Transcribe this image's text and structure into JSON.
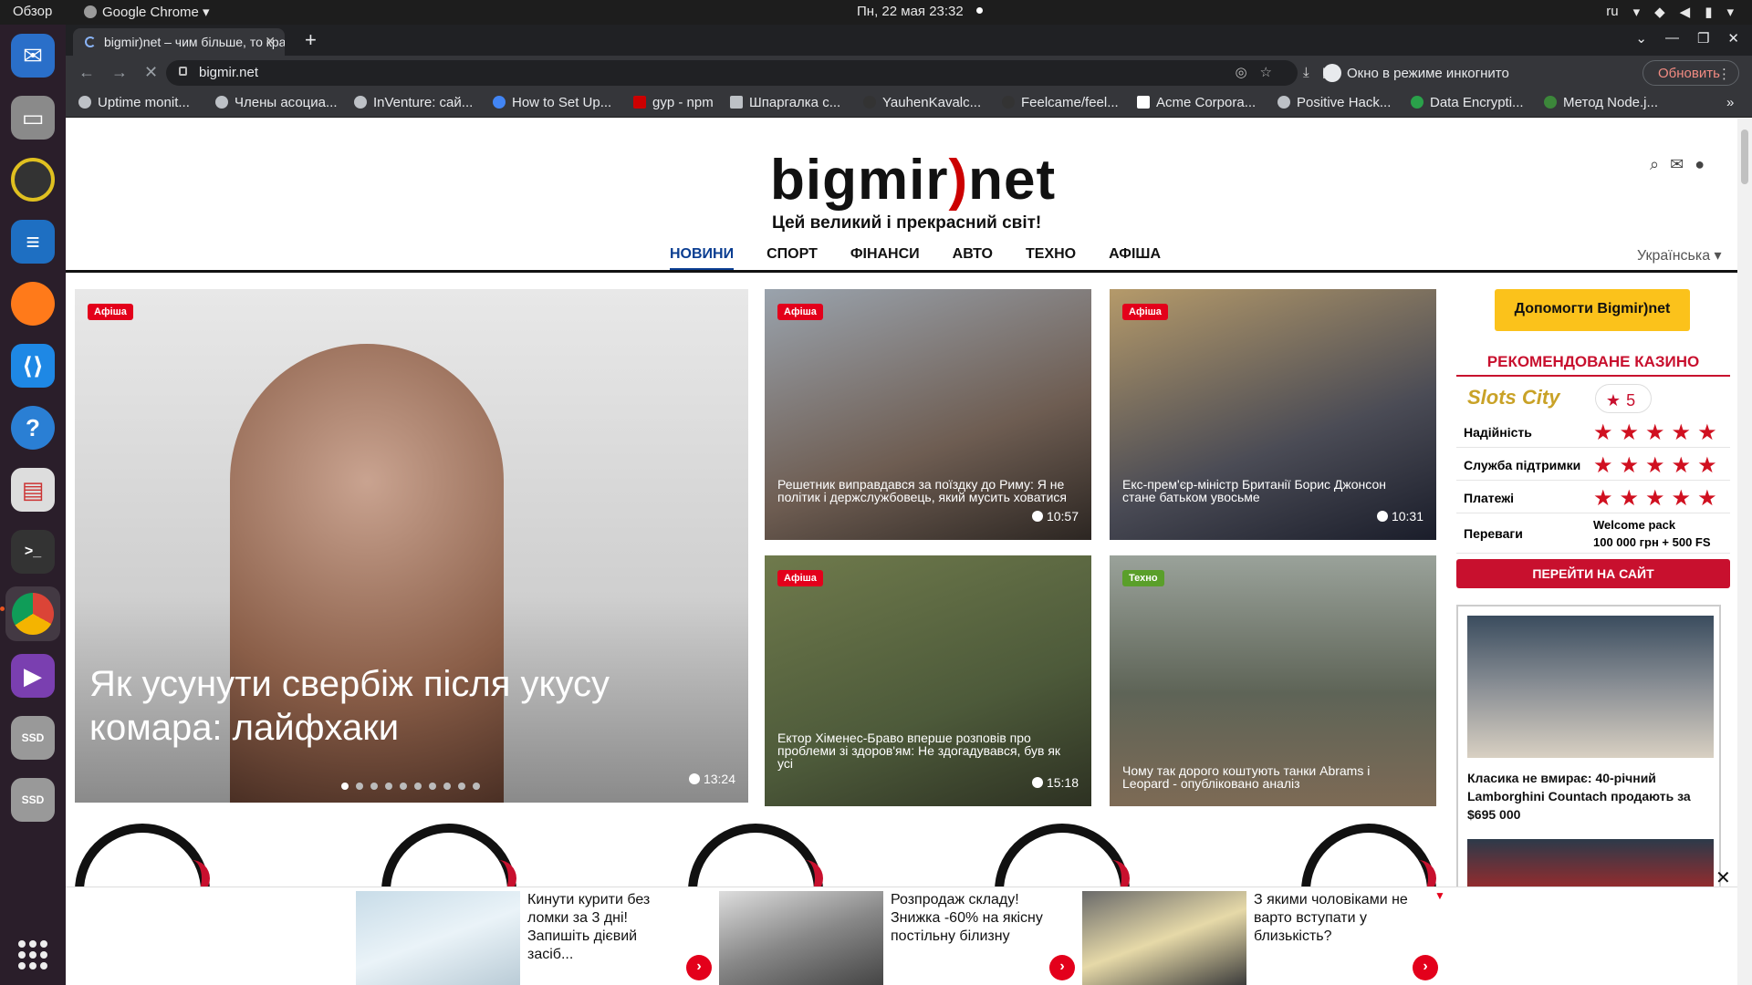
{
  "system": {
    "overview": "Обзор",
    "app_name": "Google Chrome",
    "clock": "Пн, 22 мая  23:32",
    "lang": "ru"
  },
  "dock": {
    "items": [
      "thunderbird-icon",
      "files-icon",
      "rhythmbox-icon",
      "writer-icon",
      "firefox-icon",
      "vscode-icon",
      "help-icon",
      "reader-icon",
      "terminal-icon",
      "chrome-icon",
      "video-icon",
      "ssd-icon",
      "ssd-icon"
    ],
    "ssd_label": "SSD"
  },
  "browser": {
    "tab_title": "bigmir)net – чим більше, то краще",
    "url": "bigmir.net",
    "incognito": "Окно в режиме инкогнито",
    "update": "Обновить",
    "bookmarks": [
      "Uptime monit...",
      "Члены асоциа...",
      "InVenture: сай...",
      "How to Set Up...",
      "gyp - npm",
      "Шпаргалка с...",
      "YauhenKavalc...",
      "Feelcame/feel...",
      "Acme Corpora...",
      "Positive Hack...",
      "Data Encrypti...",
      "Метод Node.j..."
    ],
    "more": "»"
  },
  "site": {
    "logo_a": "bigmir",
    "logo_b": ")",
    "logo_c": "net",
    "tagline": "Цей великий і прекрасний світ!",
    "menu": [
      "НОВИНИ",
      "СПОРТ",
      "ФІНАНСИ",
      "АВТО",
      "ТЕХНО",
      "АФІША"
    ],
    "language": "Українська ▾"
  },
  "news": {
    "hero": {
      "tag": "Афіша",
      "title": "Як усунути свербіж після укусу комара: лайфхаки",
      "time": "13:24"
    },
    "cards": [
      {
        "tag": "Афіша",
        "title": "Решетник виправдався за поїздку до Риму: Я не політик і держслужбовець, який мусить ховатися",
        "time": "10:57"
      },
      {
        "tag": "Афіша",
        "title": "Екс-прем'єр-міністр Британії Борис Джонсон стане батьком увосьме",
        "time": "10:31"
      },
      {
        "tag": "Афіша",
        "title": "Ектор Хіменес-Браво вперше розповів про проблеми зі здоров'ям: Не здогадувався, був як усі",
        "time": "15:18"
      },
      {
        "tag": "Техно",
        "title": "Чому так дорого коштують танки Abrams і Leopard - опубліковано аналіз",
        "time": ""
      }
    ]
  },
  "sidebar": {
    "help_button": "Допомогти Bigmir)net",
    "casino_heading": "РЕКОМЕНДОВАНЕ КАЗИНО",
    "casino_logo": "Slots City",
    "rating": "5",
    "rows": [
      {
        "label": "Надійність",
        "stars": "★★★★★"
      },
      {
        "label": "Служба підтримки",
        "stars": "★★★★★"
      },
      {
        "label": "Платежі",
        "stars": "★★★★★"
      }
    ],
    "perks_label": "Переваги",
    "perks_line1": "Welcome pack",
    "perks_line2": "100 000 грн + 500 FS",
    "go_button": "ПЕРЕЙТИ НА САЙТ",
    "ad_title": "Класика не вмирає: 40-річний Lamborghini Countach продають за $695 000",
    "close": "✕"
  },
  "bottom_ads": [
    {
      "text": "Кинути курити без ломки за 3 дні! Запишіть дієвий засіб..."
    },
    {
      "text": "Розпродаж складу! Знижка -60% на якісну постільну білизну"
    },
    {
      "text": "З якими чоловіками не варто вступати у близькість?"
    }
  ]
}
